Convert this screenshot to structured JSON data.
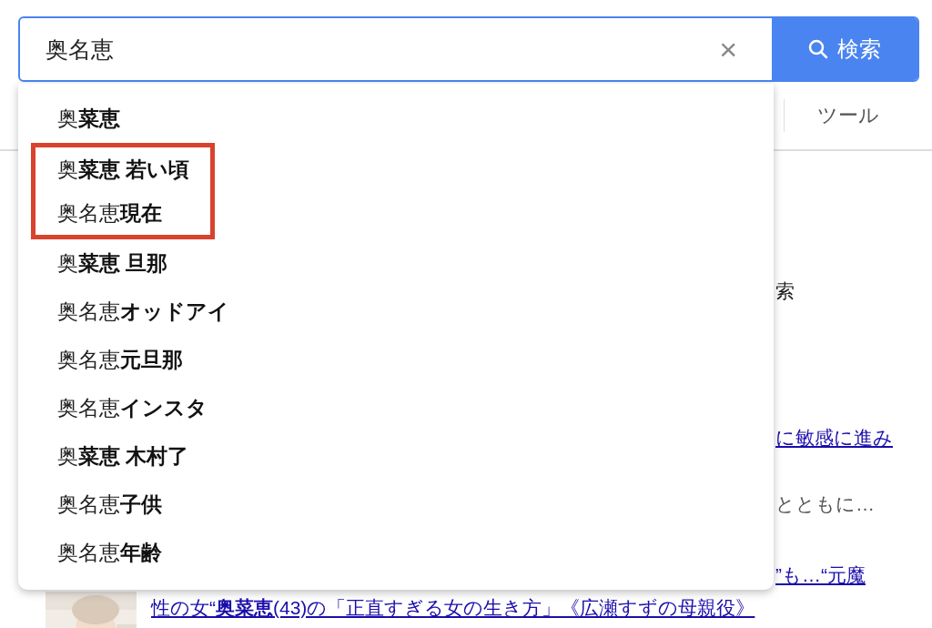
{
  "search": {
    "query": "奥名恵",
    "clear_label": "×",
    "button_label": "検索"
  },
  "suggestions": [
    {
      "text": "奥**菜恵**",
      "highlighted": false
    },
    {
      "text": "奥**菜恵 若い頃**",
      "highlighted": true
    },
    {
      "text": "奥名恵**現在**",
      "highlighted": true
    },
    {
      "text": "奥**菜恵 旦那**",
      "highlighted": false
    },
    {
      "text": "奥名恵**オッドアイ**",
      "highlighted": false
    },
    {
      "text": "奥名恵**元旦那**",
      "highlighted": false
    },
    {
      "text": "奥名恵**インスタ**",
      "highlighted": false
    },
    {
      "text": "奥**菜恵 木村了**",
      "highlighted": false
    },
    {
      "text": "奥名恵**子供**",
      "highlighted": false
    },
    {
      "text": "奥名恵**年齢**",
      "highlighted": false
    }
  ],
  "page": {
    "tools_tab": "ツール",
    "fragments": [
      {
        "kind": "text",
        "text": "索"
      },
      {
        "kind": "link",
        "text": "に敏感に進み"
      },
      {
        "kind": "snippet",
        "text": "とともに…"
      },
      {
        "kind": "link",
        "text": "”も…“元魔"
      },
      {
        "kind": "result",
        "text": "性の女“**奥菜恵**(43)の「正直すぎる女の生き方」《広瀬すずの母親役》"
      }
    ]
  }
}
